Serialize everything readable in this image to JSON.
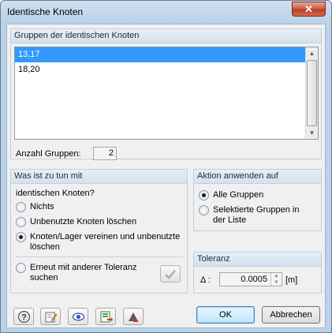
{
  "window": {
    "title": "Identische Knoten",
    "close_icon": "close-icon"
  },
  "groups_panel": {
    "heading": "Gruppen der identischen Knoten",
    "items": [
      "13,17",
      "18,20"
    ],
    "selected_index": 0,
    "count_label": "Anzahl Gruppen:",
    "count_value": "2"
  },
  "action_panel": {
    "heading": "Was ist zu tun mit",
    "subheading": "identischen Knoten?",
    "options": [
      {
        "label": "Nichts",
        "selected": false
      },
      {
        "label": "Unbenutzte Knoten löschen",
        "selected": false
      },
      {
        "label": "Knoten/Lager vereinen und unbenutzte löschen",
        "selected": true
      }
    ],
    "retry_option": {
      "label": "Erneut mit anderer Toleranz suchen",
      "selected": false
    }
  },
  "apply_panel": {
    "heading": "Aktion anwenden auf",
    "options": [
      {
        "label": "Alle Gruppen",
        "selected": true
      },
      {
        "label": "Selektierte Gruppen in der Liste",
        "selected": false
      }
    ]
  },
  "tolerance_panel": {
    "heading": "Toleranz",
    "symbol_label": "Δ :",
    "value": "0.0005",
    "unit": "[m]"
  },
  "footer": {
    "tools": [
      "help-icon",
      "edit-icon",
      "view-icon",
      "excel-export-icon",
      "units-icon"
    ],
    "ok_label": "OK",
    "cancel_label": "Abbrechen"
  }
}
